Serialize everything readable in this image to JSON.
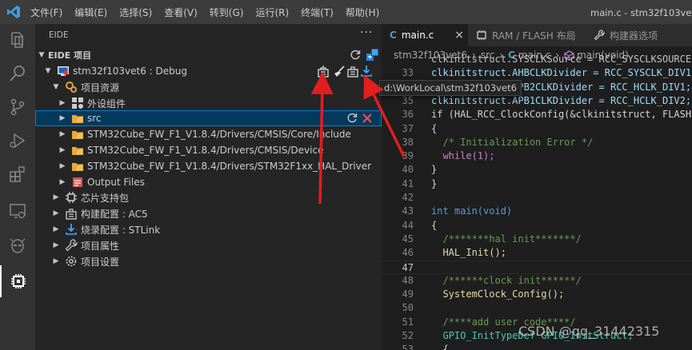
{
  "titlebar": {
    "menu": [
      "文件(F)",
      "编辑(E)",
      "选择(S)",
      "查看(V)",
      "转到(G)",
      "运行(R)",
      "终端(T)",
      "帮助(H)"
    ],
    "window_title": "main.c - stm32f103vet6 (工"
  },
  "activity": {
    "items": [
      "explorer-icon",
      "search-icon",
      "source-control-icon",
      "run-debug-icon",
      "extensions-icon",
      "remote-explorer-icon",
      "alien-icon",
      "eide-chip-icon"
    ]
  },
  "sidebar": {
    "header": "EIDE",
    "more": "···",
    "section_title": "EIDE 项目",
    "project": "stm32f103vet6 : Debug",
    "project_resources": "项目资源",
    "peripherals": "外设组件",
    "src": "src",
    "folders": [
      "STM32Cube_FW_F1_V1.8.4/Drivers/CMSIS/Core/Include",
      "STM32Cube_FW_F1_V1.8.4/Drivers/CMSIS/Device",
      "STM32Cube_FW_F1_V1.8.4/Drivers/STM32F1xx_HAL_Driver"
    ],
    "output_files": "Output Files",
    "chip_support": "芯片支持包",
    "build_config": "构建配置 : AC5",
    "flash_config": "烧录配置 : STLink",
    "project_attributes": "项目属性",
    "project_settings": "项目设置"
  },
  "tooltip": "d:\\WorkLocal\\stm32f103vet6",
  "tabs": [
    {
      "label": "main.c",
      "icon": "C",
      "close": "×"
    },
    {
      "label": "RAM / FLASH 布局"
    },
    {
      "label": "构建器选项"
    }
  ],
  "breadcrumb": [
    "stm32f103vet6",
    "src",
    "main.c",
    "main(void)"
  ],
  "code_lines": [
    {
      "n": "",
      "t": "clkinitstruct.SYSCLKSource = RCC_SYSCLKSOURCE"
    },
    {
      "n": "33",
      "t": "clkinitstruct.AHBCLKDivider = RCC_SYSCLK_DIV1"
    },
    {
      "n": "34",
      "t": "clkinitstruct.APB2CLKDivider = RCC_HCLK_DIV1;"
    },
    {
      "n": "35",
      "t": "clkinitstruct.APB1CLKDivider = RCC_HCLK_DIV2;"
    },
    {
      "n": "36",
      "t": "if (HAL_RCC_ClockConfig(&clkinitstruct, FLASH"
    },
    {
      "n": "37",
      "t": "{"
    },
    {
      "n": "38",
      "t": "  /* Initialization Error */"
    },
    {
      "n": "39",
      "t": "  while(1);"
    },
    {
      "n": "40",
      "t": "}"
    },
    {
      "n": "41",
      "t": "}"
    },
    {
      "n": "42",
      "t": ""
    },
    {
      "n": "43",
      "t": "int main(void)"
    },
    {
      "n": "44",
      "t": "{"
    },
    {
      "n": "45",
      "t": "  /*******hal init*******/"
    },
    {
      "n": "46",
      "t": "  HAL_Init();"
    },
    {
      "n": "47",
      "t": ""
    },
    {
      "n": "48",
      "t": "  /******clock init******/"
    },
    {
      "n": "49",
      "t": "  SystemClock_Config();"
    },
    {
      "n": "50",
      "t": ""
    },
    {
      "n": "51",
      "t": "  /****add user code****/"
    },
    {
      "n": "52",
      "t": "  GPIO_InitTypeDef GPIO_InitStruct;"
    },
    {
      "n": "53",
      "t": "  {"
    }
  ],
  "watermark": "CSDN @qq_31442315",
  "colors": {
    "accent": "#007fd4",
    "arrow": "#e31e1e"
  }
}
